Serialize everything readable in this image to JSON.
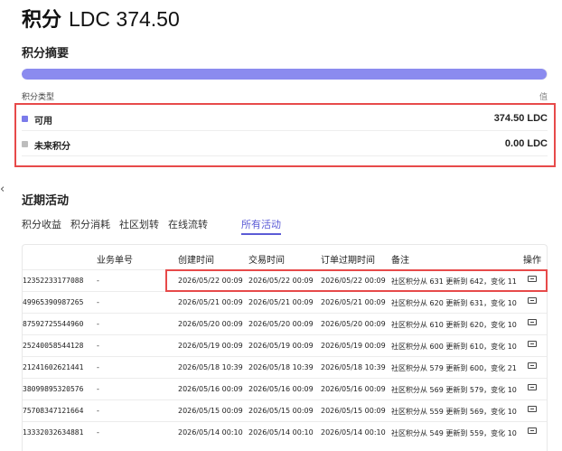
{
  "header": {
    "title": "积分",
    "amount": "LDC 374.50"
  },
  "summary": {
    "title": "积分摘要",
    "progress_fraction": 0.999,
    "type_label": "积分类型",
    "value_label": "值",
    "rows": [
      {
        "label": "可用",
        "value": "374.50 LDC",
        "color": "#7b7bea"
      },
      {
        "label": "未来积分",
        "value": "0.00 LDC",
        "color": "#bdbdbd"
      }
    ]
  },
  "recent": {
    "title": "近期活动",
    "tabs": [
      {
        "label": "积分收益",
        "active": false
      },
      {
        "label": "积分消耗",
        "active": false
      },
      {
        "label": "社区划转",
        "active": false
      },
      {
        "label": "在线流转",
        "active": false
      },
      {
        "label": "所有活动",
        "active": true
      }
    ]
  },
  "table": {
    "headers": [
      "",
      "业务单号",
      "创建时间",
      "交易时间",
      "订单过期时间",
      "备注",
      "操作"
    ],
    "rows": [
      {
        "id": "12352233177088",
        "biz": "-",
        "created": "2026/05/22 00:09",
        "traded": "2026/05/22 00:09",
        "expire": "2026/05/22 00:09",
        "note": "社区积分从 631 更新到 642，变化 11"
      },
      {
        "id": "49965390987265",
        "biz": "-",
        "created": "2026/05/21 00:09",
        "traded": "2026/05/21 00:09",
        "expire": "2026/05/21 00:09",
        "note": "社区积分从 620 更新到 631，变化 10"
      },
      {
        "id": "87592725544960",
        "biz": "-",
        "created": "2026/05/20 00:09",
        "traded": "2026/05/20 00:09",
        "expire": "2026/05/20 00:09",
        "note": "社区积分从 610 更新到 620，变化 10"
      },
      {
        "id": "25240058544128",
        "biz": "-",
        "created": "2026/05/19 00:09",
        "traded": "2026/05/19 00:09",
        "expire": "2026/05/19 00:09",
        "note": "社区积分从 600 更新到 610，变化 10"
      },
      {
        "id": "21241602621441",
        "biz": "-",
        "created": "2026/05/18 10:39",
        "traded": "2026/05/18 10:39",
        "expire": "2026/05/18 10:39",
        "note": "社区积分从 579 更新到 600，变化 21"
      },
      {
        "id": "38099895320576",
        "biz": "-",
        "created": "2026/05/16 00:09",
        "traded": "2026/05/16 00:09",
        "expire": "2026/05/16 00:09",
        "note": "社区积分从 569 更新到 579，变化 10"
      },
      {
        "id": "75708347121664",
        "biz": "-",
        "created": "2026/05/15 00:09",
        "traded": "2026/05/15 00:09",
        "expire": "2026/05/15 00:09",
        "note": "社区积分从 559 更新到 569，变化 10"
      },
      {
        "id": "13332032634881",
        "biz": "-",
        "created": "2026/05/14 00:10",
        "traded": "2026/05/14 00:10",
        "expire": "2026/05/14 00:10",
        "note": "社区积分从 549 更新到 559，变化 10"
      }
    ]
  }
}
